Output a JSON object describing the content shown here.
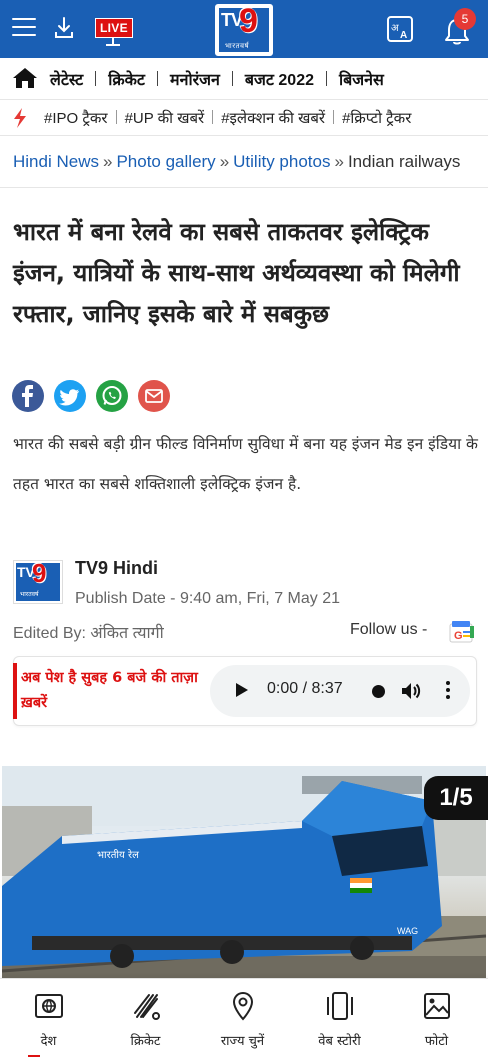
{
  "header": {
    "live_label": "LIVE",
    "logo_tv": "TV",
    "logo_nine": "9",
    "logo_sub": "भारतवर्ष",
    "notification_count": "5"
  },
  "nav": {
    "items": [
      {
        "label": "लेटेस्ट"
      },
      {
        "label": "क्रिकेट"
      },
      {
        "label": "मनोरंजन"
      },
      {
        "label": "बजट 2022"
      },
      {
        "label": "बिजनेस"
      }
    ]
  },
  "trending": {
    "tags": [
      {
        "label": "#IPO ट्रैकर"
      },
      {
        "label": "#UP की खबरें"
      },
      {
        "label": "#इलेक्शन की खबरें"
      },
      {
        "label": "#क्रिप्टो ट्रैकर"
      }
    ]
  },
  "breadcrumb": {
    "items": [
      {
        "label": "Hindi News"
      },
      {
        "label": "Photo gallery"
      },
      {
        "label": "Utility photos"
      },
      {
        "label": "Indian railways"
      }
    ],
    "separator": "»"
  },
  "article": {
    "headline": "भारत में बना रेलवे का सबसे ताकतवर इलेक्ट्रिक इंजन, यात्रियों के साथ-साथ अर्थव्यवस्था को मिलेगी रफ्तार, जानिए इसके बारे में सबकुछ",
    "summary": "भारत की सबसे बड़ी ग्रीन फील्ड विनिर्माण सुविधा में बना यह इंजन मेड इन इंडिया के तहत भारत का सबसे शक्तिशाली इलेक्ट्रिक इंजन है.",
    "author": "TV9 Hindi",
    "publish_date": "Publish Date - 9:40 am, Fri, 7 May 21",
    "edited_by": "Edited By: अंकित त्यागी",
    "follow_us": "Follow us -"
  },
  "audio": {
    "title": "अब पेश है सुबह 6 बजे की ताज़ा ख़बरें",
    "time": "0:00 / 8:37"
  },
  "gallery": {
    "counter": "1/5",
    "loco_text": "भारतीय रेल",
    "loco_model": "WAG"
  },
  "bottom_nav": {
    "tabs": [
      {
        "label": "देश"
      },
      {
        "label": "क्रिकेट"
      },
      {
        "label": "राज्य चुनें"
      },
      {
        "label": "वेब स्टोरी"
      },
      {
        "label": "फोटो"
      }
    ]
  },
  "colors": {
    "brand_blue": "#1a5fb4",
    "accent_red": "#d11",
    "link_blue": "#1a5fb4"
  }
}
